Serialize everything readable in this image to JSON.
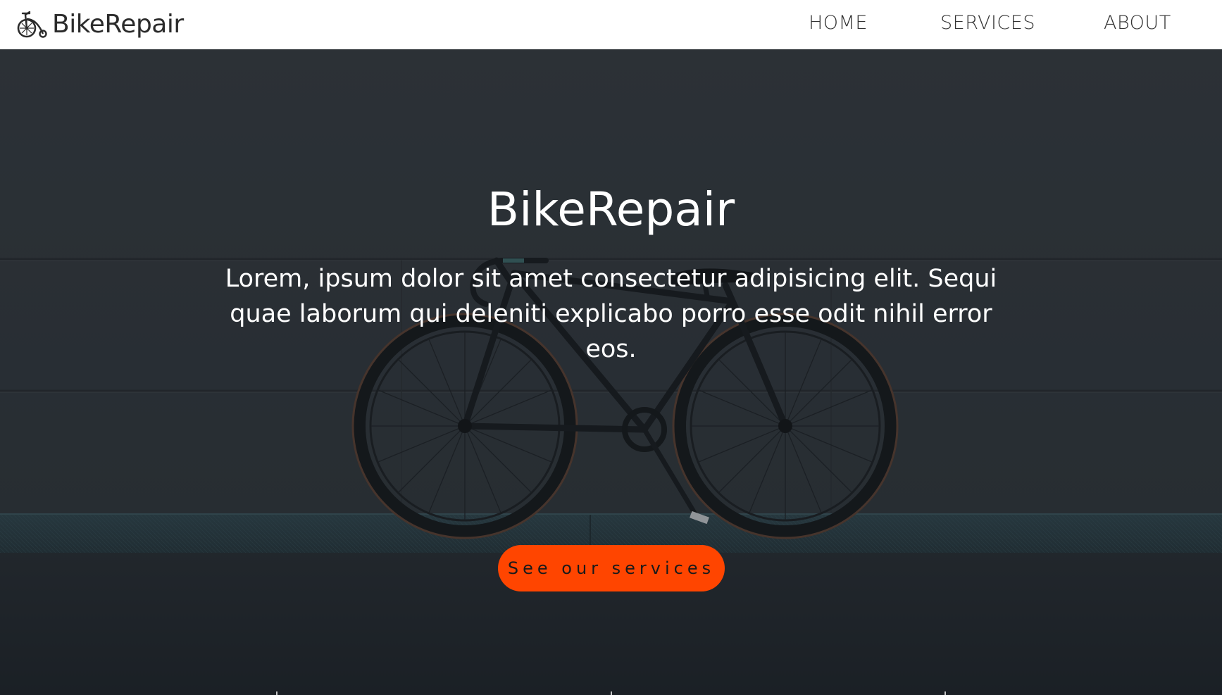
{
  "navbar": {
    "brand": "BikeRepair",
    "brand_icon": "penny-farthing-bicycle-icon",
    "links": [
      {
        "label": "HOME"
      },
      {
        "label": "SERVICES"
      },
      {
        "label": "ABOUT"
      }
    ]
  },
  "hero": {
    "title": "BikeRepair",
    "description": "Lorem, ipsum dolor sit amet consectetur adipisicing elit. Sequi quae laborum qui deleniti explicabo porro esse odit nihil error eos.",
    "cta_label": "See our services",
    "background": "bicycle-leaning-against-concrete-wall-photo"
  },
  "colors": {
    "accent": "#ff4500",
    "navbar_bg": "#ffffff",
    "text_light": "#ffffff",
    "text_dark": "#2b2b2b"
  }
}
